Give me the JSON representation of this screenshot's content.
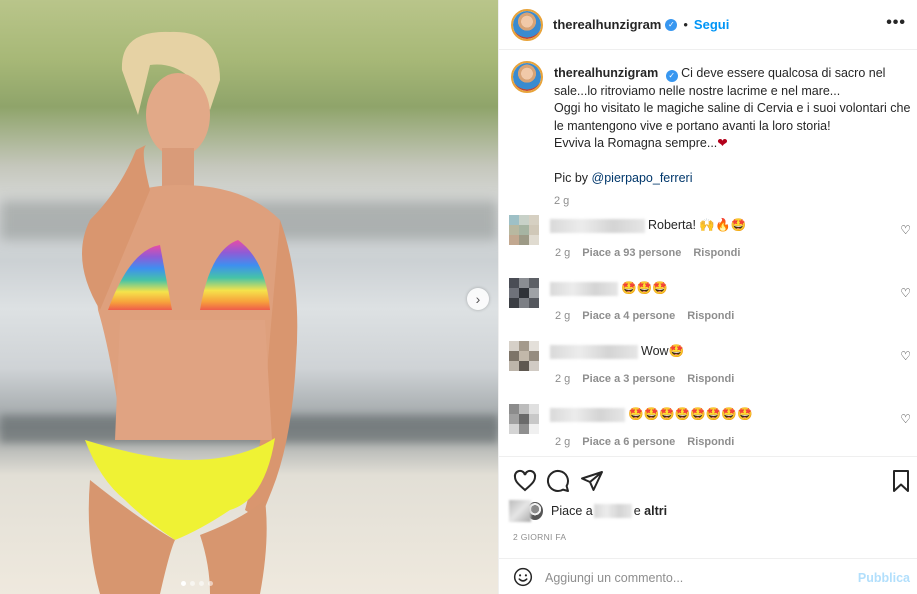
{
  "post": {
    "photo_alt": "",
    "carousel": {
      "slide_count": 4,
      "active_index": 0,
      "next_symbol": "›"
    }
  },
  "header": {
    "username": "therealhunzigram",
    "separator": "•",
    "follow_label": "Segui",
    "more_label": "•••"
  },
  "caption": {
    "username": "therealhunzigram",
    "line1": "Ci deve essere qualcosa di sacro nel sale...lo ritroviamo nelle nostre lacrime e nel mare...",
    "line2": "Oggi ho visitato le magiche saline di Cervia e i suoi volontari che le mantengono vive e portano avanti la loro storia!",
    "line3": "Evviva la Romagna sempre...",
    "line3_emoji": "❤",
    "pic_by": "Pic by",
    "mention": "@pierpapo_ferreri",
    "time": "2 g"
  },
  "comments": [
    {
      "text": "Roberta! 🙌🔥🤩",
      "time": "2 g",
      "likes": "Piace a 93 persone",
      "reply": "Rispondi"
    },
    {
      "text": "🤩🤩🤩",
      "time": "2 g",
      "likes": "Piace a 4 persone",
      "reply": "Rispondi"
    },
    {
      "text": "Wow🤩",
      "time": "2 g",
      "likes": "Piace a 3 persone",
      "reply": "Rispondi"
    },
    {
      "text": "🤩🤩🤩🤩🤩🤩🤩🤩",
      "time": "2 g",
      "likes": "Piace a 6 persone",
      "reply": "Rispondi"
    }
  ],
  "likes": {
    "prefix": "Piace a",
    "suffix": "e",
    "others": "altri"
  },
  "date": "2 GIORNI FA",
  "composer": {
    "placeholder": "Aggiungi un commento...",
    "publish_label": "Pubblica"
  },
  "colors": {
    "accent": "#0095f6",
    "publish_disabled": "#b2dffc",
    "verified": "#3897f0"
  }
}
